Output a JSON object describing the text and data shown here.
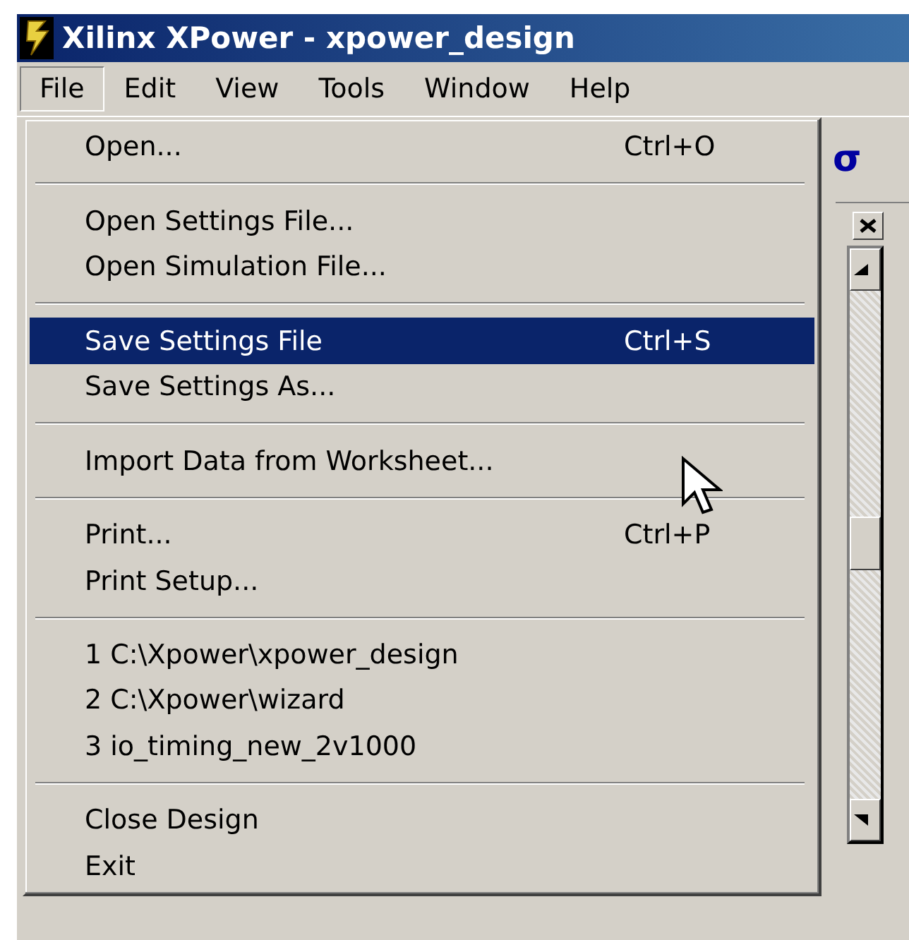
{
  "window": {
    "title": "Xilinx XPower - xpower_design"
  },
  "menubar": [
    {
      "label": "File",
      "selected": true
    },
    {
      "label": "Edit",
      "selected": false
    },
    {
      "label": "View",
      "selected": false
    },
    {
      "label": "Tools",
      "selected": false
    },
    {
      "label": "Window",
      "selected": false
    },
    {
      "label": "Help",
      "selected": false
    }
  ],
  "file_menu": [
    [
      {
        "label": "Open...",
        "shortcut": "Ctrl+O",
        "selected": false
      }
    ],
    [
      {
        "label": "Open Settings File...",
        "selected": false
      },
      {
        "label": "Open Simulation File...",
        "selected": false
      }
    ],
    [
      {
        "label": "Save Settings File",
        "shortcut": "Ctrl+S",
        "selected": true
      },
      {
        "label": "Save Settings As...",
        "selected": false
      }
    ],
    [
      {
        "label": "Import Data from Worksheet...",
        "selected": false
      }
    ],
    [
      {
        "label": "Print...",
        "shortcut": "Ctrl+P",
        "selected": false
      },
      {
        "label": "Print Setup...",
        "selected": false
      }
    ],
    [
      {
        "label": "1 C:\\Xpower\\xpower_design",
        "selected": false
      },
      {
        "label": "2 C:\\Xpower\\wizard",
        "selected": false
      },
      {
        "label": "3 io_timing_new_2v1000",
        "selected": false
      }
    ],
    [
      {
        "label": "Close Design",
        "selected": false
      },
      {
        "label": "Exit",
        "selected": false
      }
    ]
  ],
  "toolbar": {
    "glyph": "σ"
  }
}
